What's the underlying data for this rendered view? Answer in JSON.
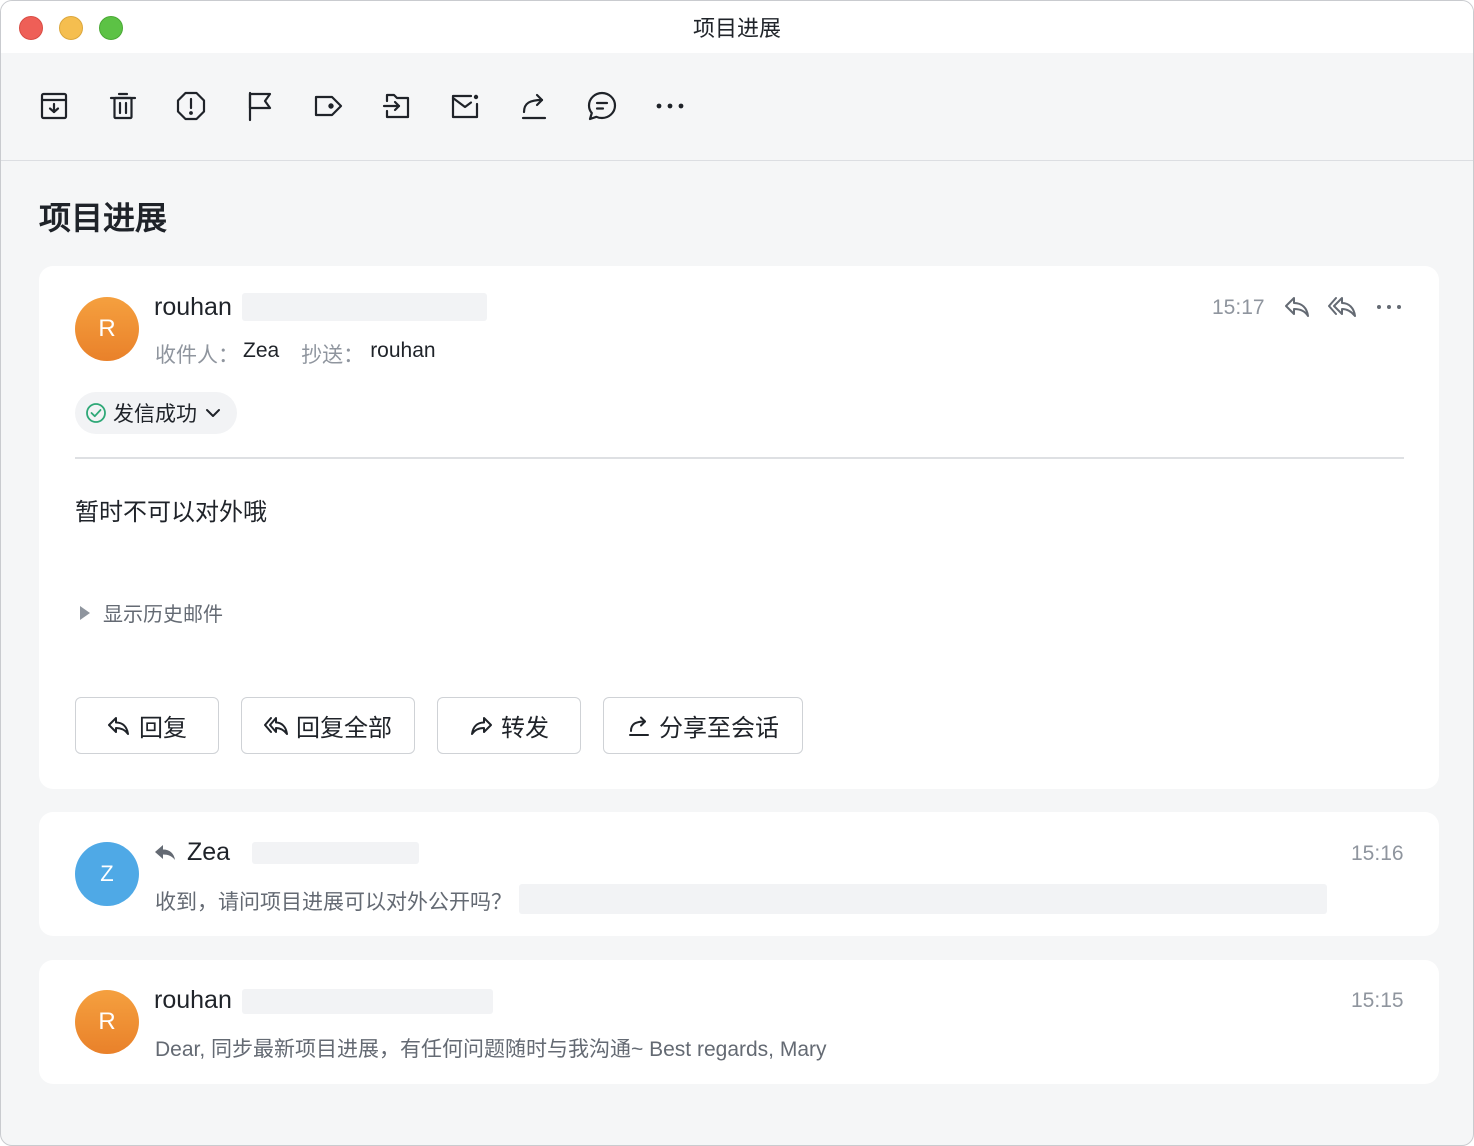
{
  "window": {
    "title": "项目进展"
  },
  "toolbar": {
    "icons": [
      "archive-icon",
      "trash-icon",
      "spam-icon",
      "flag-icon",
      "label-icon",
      "move-icon",
      "mark-unread-icon",
      "share-icon",
      "comment-icon",
      "more-icon"
    ]
  },
  "subject": "项目进展",
  "main_message": {
    "avatar_letter": "R",
    "sender": "rouhan",
    "to_label": "收件人：",
    "to_value": "Zea",
    "cc_label": "抄送：",
    "cc_value": "rouhan",
    "time": "15:17",
    "status": "发信成功",
    "body": "暂时不可以对外哦",
    "history_label": "显示历史邮件",
    "buttons": {
      "reply": "回复",
      "reply_all": "回复全部",
      "forward": "转发",
      "share": "分享至会话"
    }
  },
  "thread": [
    {
      "avatar_letter": "Z",
      "sender": "Zea",
      "time": "15:16",
      "preview": "收到，请问项目进展可以对外公开吗？"
    },
    {
      "avatar_letter": "R",
      "sender": "rouhan",
      "time": "15:15",
      "preview": "Dear, 同步最新项目进展，有任何问题随时与我沟通~ Best regards, Mary"
    }
  ],
  "colors": {
    "accent_orange": "#e9812a",
    "accent_blue": "#4fa9e6",
    "success_green": "#2ea877",
    "background": "#f5f6f7"
  }
}
